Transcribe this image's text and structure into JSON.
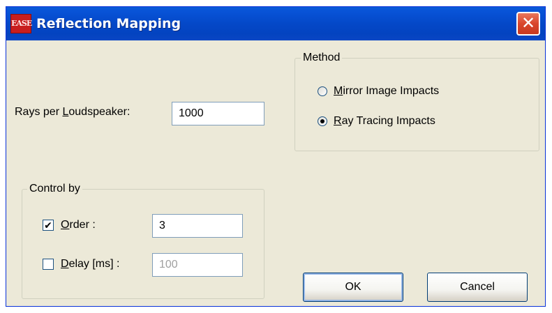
{
  "window": {
    "title": "Reflection Mapping",
    "icon_text": "EASE",
    "close_glyph": "✕"
  },
  "rays": {
    "label_prefix": "Rays per ",
    "label_accel": "L",
    "label_suffix": "oudspeaker:",
    "value": "1000"
  },
  "method": {
    "legend": "Method",
    "options": [
      {
        "accel": "M",
        "rest": "irror Image Impacts",
        "checked": false
      },
      {
        "accel": "R",
        "rest": "ay Tracing Impacts",
        "checked": true
      }
    ]
  },
  "control_by": {
    "legend": "Control by",
    "order": {
      "accel": "O",
      "rest": "rder :",
      "checked": true,
      "check_glyph": "✔",
      "value": "3"
    },
    "delay": {
      "accel": "D",
      "rest": "elay [ms] :",
      "checked": false,
      "value": "100"
    }
  },
  "buttons": {
    "ok": "OK",
    "cancel": "Cancel"
  },
  "colors": {
    "titlebar": "#0448c8",
    "dialog_bg": "#ece9d8",
    "close_button": "#d9462c",
    "field_border": "#7f9db9",
    "disabled_text": "#a0a0a0"
  }
}
